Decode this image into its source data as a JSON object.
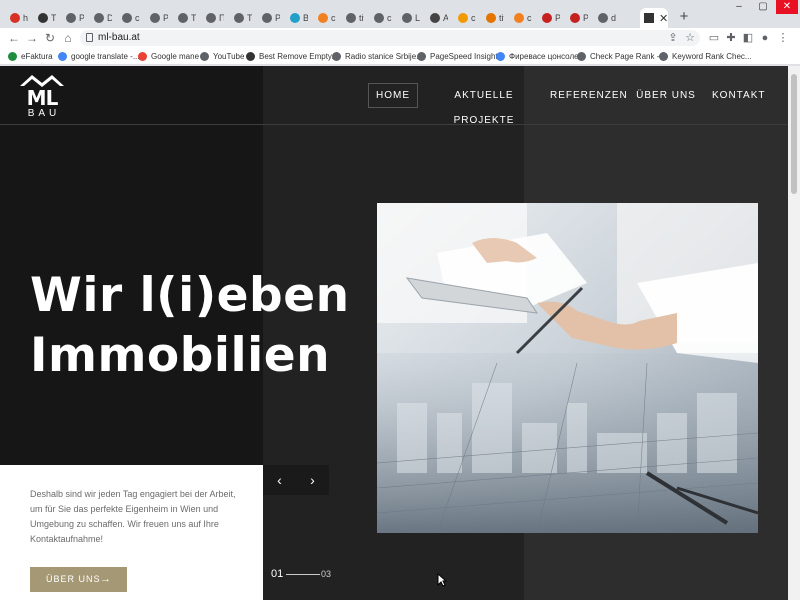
{
  "browser": {
    "tabs": [
      {
        "title": "ht",
        "icon": "gmail-icon",
        "color": "#d93025"
      },
      {
        "title": "Tr",
        "icon": "site-icon",
        "color": "#333333"
      },
      {
        "title": "Pr",
        "icon": "globe-icon",
        "color": "#5f6368"
      },
      {
        "title": "Dr",
        "icon": "globe-icon",
        "color": "#5f6368"
      },
      {
        "title": "cF",
        "icon": "globe-icon",
        "color": "#5f6368"
      },
      {
        "title": "Pi",
        "icon": "globe-icon",
        "color": "#5f6368"
      },
      {
        "title": "TL",
        "icon": "globe-icon",
        "color": "#5f6368"
      },
      {
        "title": "Пс",
        "icon": "globe-icon",
        "color": "#5f6368"
      },
      {
        "title": "TL",
        "icon": "globe-icon",
        "color": "#5f6368"
      },
      {
        "title": "Pc",
        "icon": "globe-icon",
        "color": "#5f6368"
      },
      {
        "title": "Be",
        "icon": "n-logo-icon",
        "color": "#22a0c8"
      },
      {
        "title": "cF",
        "icon": "cloudflare-icon",
        "color": "#f38020"
      },
      {
        "title": "tit",
        "icon": "globe-icon",
        "color": "#5f6368"
      },
      {
        "title": "cF",
        "icon": "globe-icon",
        "color": "#5f6368"
      },
      {
        "title": "Lo",
        "icon": "globe-icon",
        "color": "#5f6368"
      },
      {
        "title": "Ar",
        "icon": "ml-logo-icon",
        "color": "#444444"
      },
      {
        "title": "cF",
        "icon": "orange-square-icon",
        "color": "#f29900"
      },
      {
        "title": "tit",
        "icon": "crown-icon",
        "color": "#e37400"
      },
      {
        "title": "cF",
        "icon": "cloudflare-icon",
        "color": "#f38020"
      },
      {
        "title": "Pl",
        "icon": "red-circle-icon",
        "color": "#c5221f"
      },
      {
        "title": "Pl",
        "icon": "red-circle-icon",
        "color": "#c5221f"
      },
      {
        "title": "de",
        "icon": "globe-icon",
        "color": "#5f6368"
      }
    ],
    "url": "ml-bau.at",
    "bookmarks": [
      {
        "label": "eFaktura",
        "icon": "efaktura-icon",
        "color": "#1e8e3e"
      },
      {
        "label": "google translate -...",
        "icon": "google-icon",
        "color": "#4285f4"
      },
      {
        "label": "Google mane",
        "icon": "maps-pin-icon",
        "color": "#ea4335"
      },
      {
        "label": "YouTube",
        "icon": "globe-icon",
        "color": "#5f6368"
      },
      {
        "label": "Best Remove Empty...",
        "icon": "cb-icon",
        "color": "#333333"
      },
      {
        "label": "Radio stanice Srbije...",
        "icon": "globe-icon",
        "color": "#5f6368"
      },
      {
        "label": "PageSpeed Insights",
        "icon": "globe-icon",
        "color": "#5f6368"
      },
      {
        "label": "Фиревасе цонсоле",
        "icon": "google-icon",
        "color": "#4285f4"
      },
      {
        "label": "Check Page Rank -...",
        "icon": "globe-icon",
        "color": "#5f6368"
      },
      {
        "label": "Keyword Rank Chec...",
        "icon": "globe-icon",
        "color": "#5f6368"
      }
    ]
  },
  "site": {
    "logo": {
      "line1": "ML",
      "line2": "BAU"
    },
    "nav": [
      "HOME",
      "AKTUELLE PROJEKTE",
      "REFERENZEN",
      "ÜBER UNS",
      "KONTAKT"
    ],
    "hero": {
      "line1": "Wir l(i)eben",
      "line2": "Immobilien"
    },
    "intro": "Deshalb sind wir jeden Tag engagiert bei der Arbeit, um für Sie das perfekte Eigenheim in Wien und Umgebung zu schaffen. Wir freuen uns auf Ihre Kontaktaufnahme!",
    "cta": "ÜBER UNS",
    "slider": {
      "current": "01",
      "total": "03"
    },
    "colors": {
      "accent": "#a59875",
      "dark": "#161616"
    }
  }
}
